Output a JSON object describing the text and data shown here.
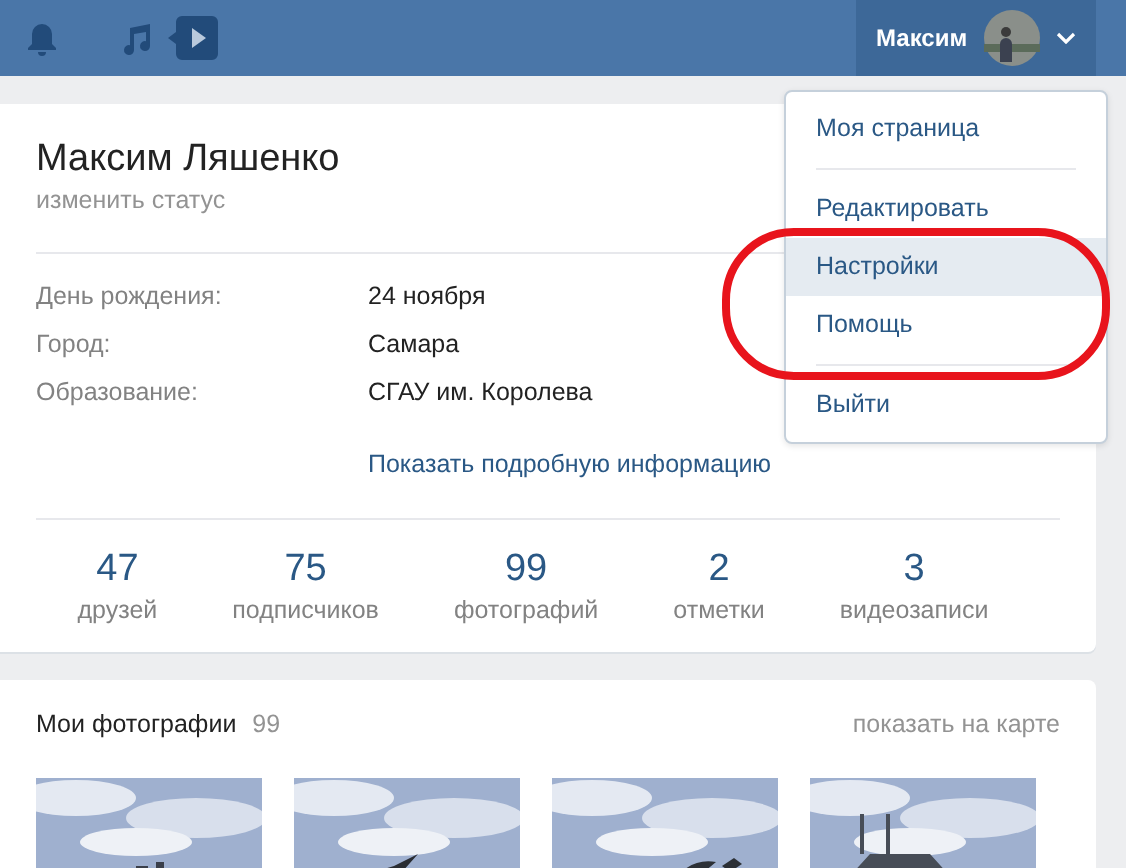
{
  "header": {
    "user_name": "Максим"
  },
  "profile": {
    "name": "Максим Ляшенко",
    "status_link": "изменить статус",
    "info": [
      {
        "label": "День рождения:",
        "value": "24 ноября"
      },
      {
        "label": "Город:",
        "value": "Самара"
      },
      {
        "label": "Образование:",
        "value": "СГАУ им. Королева"
      }
    ],
    "more_link": "Показать подробную информацию",
    "counters": [
      {
        "value": "47",
        "label": "друзей"
      },
      {
        "value": "75",
        "label": "подписчиков"
      },
      {
        "value": "99",
        "label": "фотографий"
      },
      {
        "value": "2",
        "label": "отметки"
      },
      {
        "value": "3",
        "label": "видеозаписи"
      }
    ]
  },
  "photos": {
    "title": "Мои фотографии",
    "count": "99",
    "map_link": "показать на карте"
  },
  "menu": {
    "groups": [
      [
        {
          "label": "Моя страница",
          "selected": false
        }
      ],
      [
        {
          "label": "Редактировать",
          "selected": false
        },
        {
          "label": "Настройки",
          "selected": true
        },
        {
          "label": "Помощь",
          "selected": false
        }
      ],
      [
        {
          "label": "Выйти",
          "selected": false
        }
      ]
    ]
  },
  "annotations": [
    {
      "kind": "ellipse"
    }
  ]
}
